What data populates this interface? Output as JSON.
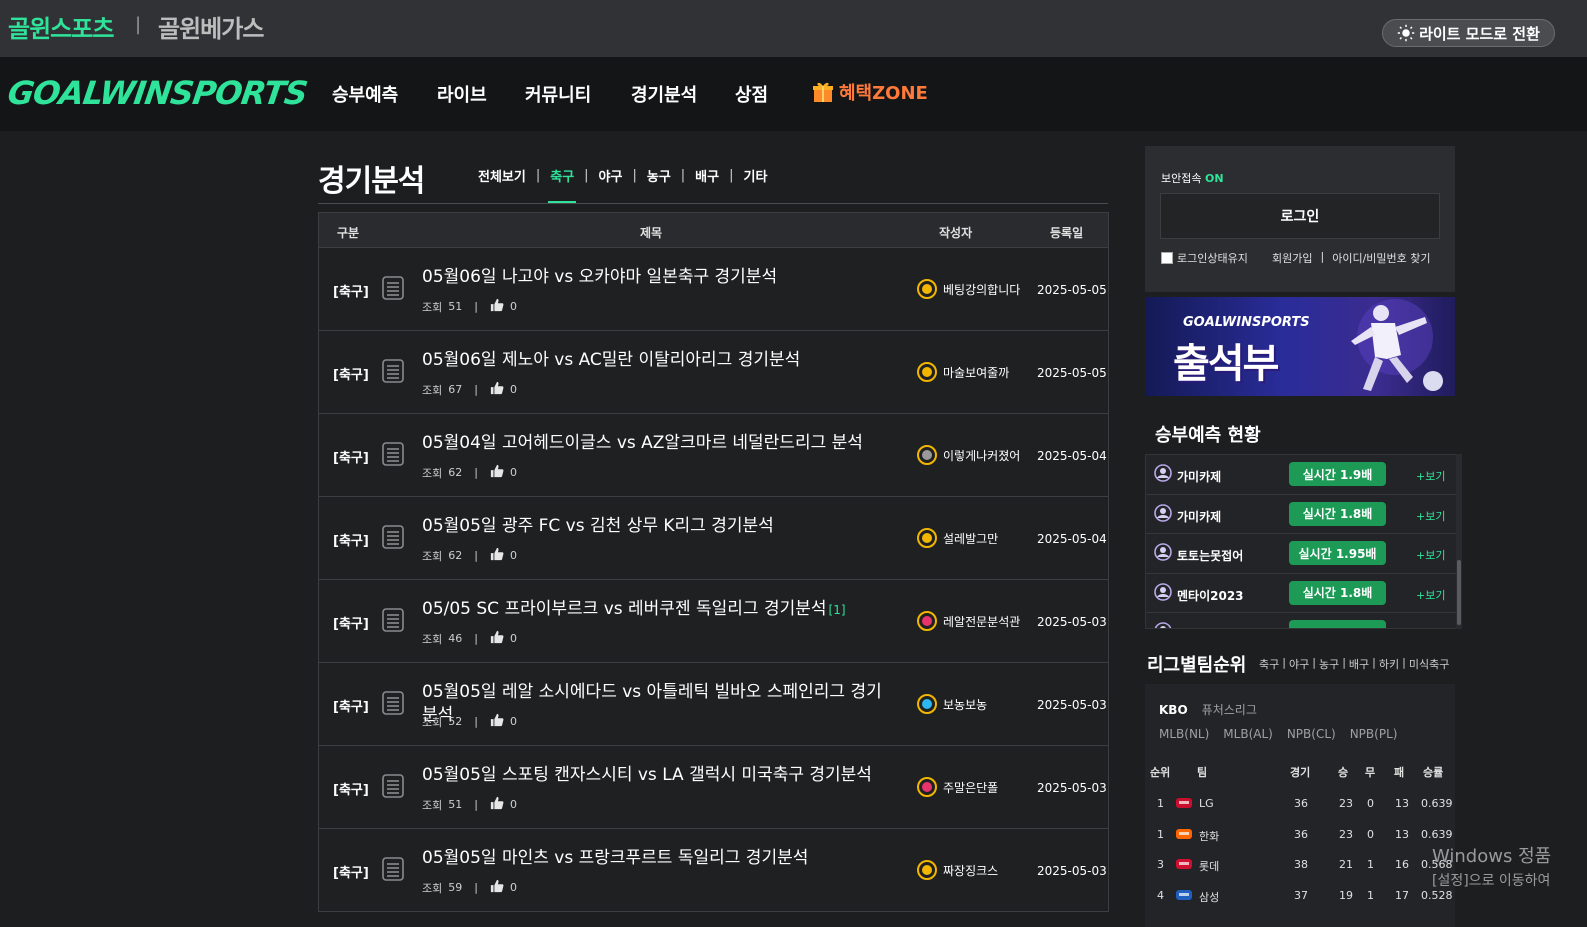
{
  "topbar": {
    "brand_primary": "골윈스포츠",
    "brand_separator": "|",
    "brand_secondary": "골윈베가스",
    "mode_toggle": "라이트 모드로 전환"
  },
  "nav": {
    "logo": "GOALWINSPORTS",
    "items": [
      "승부예측",
      "라이브",
      "커뮤니티",
      "경기분석",
      "상점"
    ],
    "benefit": "혜택ZONE"
  },
  "page": {
    "title": "경기분석",
    "subtabs": [
      "전체보기",
      "축구",
      "야구",
      "농구",
      "배구",
      "기타"
    ],
    "active_subtab": "축구"
  },
  "table": {
    "headers": {
      "category": "구분",
      "title": "제목",
      "author": "작성자",
      "date": "등록일"
    },
    "view_label": "조회",
    "rows": [
      {
        "category": "[축구]",
        "title": "05월06일 나고야 vs 오카야마 일본축구 경기분석",
        "comments": "",
        "views": "51",
        "likes": "0",
        "author": "베팅강의합니다",
        "badge_color": "#f2b600",
        "date": "2025-05-05"
      },
      {
        "category": "[축구]",
        "title": "05월06일 제노아 vs AC밀란 이탈리아리그 경기분석",
        "comments": "",
        "views": "67",
        "likes": "0",
        "author": "마술보여줄까",
        "badge_color": "#f2b600",
        "date": "2025-05-05"
      },
      {
        "category": "[축구]",
        "title": "05월04일 고어헤드이글스 vs AZ알크마르 네덜란드리그 분석",
        "comments": "",
        "views": "62",
        "likes": "0",
        "author": "이렇게나커졌어",
        "badge_color": "#9a9a9a",
        "date": "2025-05-04"
      },
      {
        "category": "[축구]",
        "title": "05월05일 광주 FC vs 김천 상무 K리그 경기분석",
        "comments": "",
        "views": "62",
        "likes": "0",
        "author": "설레발그만",
        "badge_color": "#f2b600",
        "date": "2025-05-04"
      },
      {
        "category": "[축구]",
        "title": "05/05 SC 프라이부르크 vs 레버쿠젠 독일리그 경기분석",
        "comments": "[1]",
        "views": "46",
        "likes": "0",
        "author": "레알전문분석관",
        "badge_color": "#e8336d",
        "date": "2025-05-03"
      },
      {
        "category": "[축구]",
        "title": "05월05일 레알 소시에다드 vs 아틀레틱 빌바오 스페인리그 경기분석",
        "comments": "",
        "views": "52",
        "likes": "0",
        "author": "보농보농",
        "badge_color": "#2bb8f0",
        "date": "2025-05-03"
      },
      {
        "category": "[축구]",
        "title": "05월05일 스포팅 캔자스시티 vs LA 갤럭시 미국축구 경기분석",
        "comments": "",
        "views": "51",
        "likes": "0",
        "author": "주말은단폴",
        "badge_color": "#e8336d",
        "date": "2025-05-03"
      },
      {
        "category": "[축구]",
        "title": "05월05일 마인츠 vs 프랑크푸르트 독일리그 경기분석",
        "comments": "",
        "views": "59",
        "likes": "0",
        "author": "짜장징크스",
        "badge_color": "#f2b600",
        "date": "2025-05-03"
      }
    ]
  },
  "login": {
    "security_label": "보안접속",
    "security_status": "ON",
    "button": "로그인",
    "keep_login": "로그인상태유지",
    "signup": "회원가입",
    "find": "아이디/비밀번호 찾기",
    "separator": "|"
  },
  "banner": {
    "sub": "GOALWINSPORTS",
    "main": "출석부"
  },
  "predictions": {
    "title": "승부예측 현황",
    "more": "+보기",
    "rows": [
      {
        "name": "가미카제",
        "rate": "실시간 1.9배"
      },
      {
        "name": "가미카제",
        "rate": "실시간 1.8배"
      },
      {
        "name": "토토는못접어",
        "rate": "실시간 1.95배"
      },
      {
        "name": "멘타이2023",
        "rate": "실시간 1.8배"
      }
    ]
  },
  "league": {
    "title": "리그별팀순위",
    "sports": [
      "축구",
      "|",
      "야구",
      "|",
      "농구",
      "|",
      "배구",
      "|",
      "하키",
      "|",
      "미식축구"
    ],
    "tabs": [
      "KBO",
      "퓨처스리그",
      "MLB(NL)",
      "MLB(AL)",
      "NPB(CL)",
      "NPB(PL)"
    ],
    "active_tab": "KBO",
    "headers": {
      "rank": "순위",
      "team": "팀",
      "games": "경기",
      "win": "승",
      "draw": "무",
      "loss": "패",
      "pct": "승률"
    },
    "rows": [
      {
        "rank": "1",
        "team": "LG",
        "games": "36",
        "win": "23",
        "draw": "0",
        "loss": "13",
        "pct": "0.639"
      },
      {
        "rank": "1",
        "team": "한화",
        "games": "36",
        "win": "23",
        "draw": "0",
        "loss": "13",
        "pct": "0.639"
      },
      {
        "rank": "3",
        "team": "롯데",
        "games": "38",
        "win": "21",
        "draw": "1",
        "loss": "16",
        "pct": "0.568"
      },
      {
        "rank": "4",
        "team": "삼성",
        "games": "37",
        "win": "19",
        "draw": "1",
        "loss": "17",
        "pct": "0.528"
      }
    ]
  },
  "watermark": {
    "line1": "Windows 정품",
    "line2": "[설정]으로 이동하여"
  },
  "colors": {
    "accent": "#2fe39a",
    "benefit": "#ff7a3a",
    "pill": "#1e9a57"
  }
}
